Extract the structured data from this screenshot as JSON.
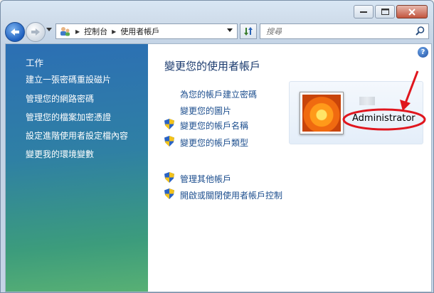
{
  "breadcrumb": {
    "root": "控制台",
    "current": "使用者帳戶"
  },
  "search": {
    "placeholder": "搜尋"
  },
  "sidebar": {
    "title": "工作",
    "links": [
      {
        "label": "建立一張密碼重設磁片"
      },
      {
        "label": "管理您的網路密碼"
      },
      {
        "label": "管理您的檔案加密憑證"
      },
      {
        "label": "設定進階使用者設定檔內容"
      },
      {
        "label": "變更我的環境變數"
      }
    ]
  },
  "main": {
    "title": "變更您的使用者帳戶",
    "tasks": [
      {
        "label": "為您的帳戶建立密碼",
        "shield": false
      },
      {
        "label": "變更您的圖片",
        "shield": false
      },
      {
        "label": "變更您的帳戶名稱",
        "shield": true
      },
      {
        "label": "變更您的帳戶類型",
        "shield": true
      }
    ],
    "other_tasks": [
      {
        "label": "管理其他帳戶",
        "shield": true
      },
      {
        "label": "開啟或關閉使用者帳戶控制",
        "shield": true
      }
    ]
  },
  "account": {
    "name": "Administrator"
  },
  "help": {
    "label": "?"
  },
  "colors": {
    "annotation": "#e0161e",
    "link": "#1c4e8e",
    "sidebar_top": "#2c6fb4",
    "sidebar_bottom": "#58b074"
  },
  "icons": [
    "back-arrow-icon",
    "forward-arrow-icon",
    "users-folder-icon",
    "refresh-icon",
    "search-icon",
    "uac-shield-icon",
    "help-icon"
  ]
}
